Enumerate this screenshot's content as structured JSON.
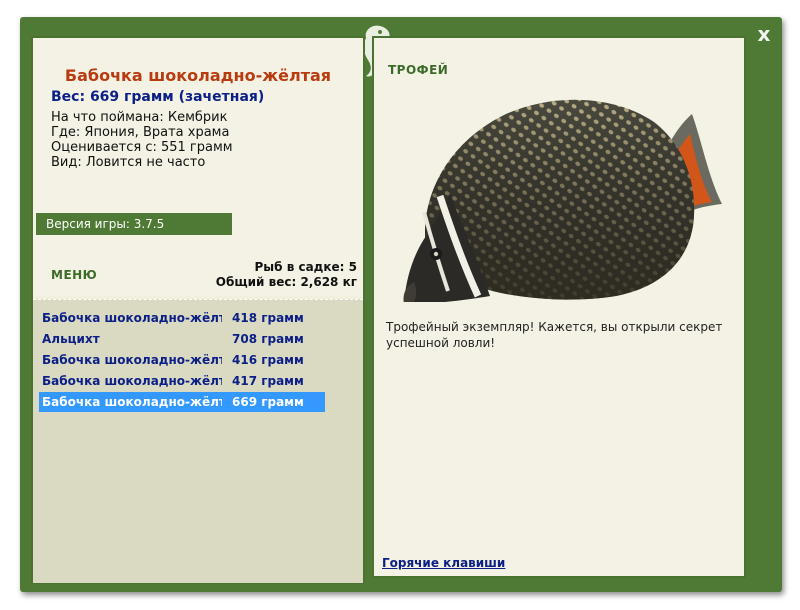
{
  "window": {
    "close_label": "x"
  },
  "catch": {
    "title": "Бабочка шоколадно-жёлтая",
    "weight_line": "Вес: 669 грамм (зачетная)",
    "bait_line": "На что поймана: Кембрик",
    "location_line": "Где: Япония, Врата храма",
    "price_line": "Оценивается с: 551 грамм",
    "rarity_line": "Вид: Ловится не часто"
  },
  "version_label": "Версия игры: 3.7.5",
  "menu_label": "МЕНЮ",
  "cage": {
    "fish_count_line": "Рыб в садке: 5",
    "total_weight_line": "Общий вес: 2,628 кг"
  },
  "fish_list": [
    {
      "name": "Бабочка шоколадно-жёлтая",
      "weight": "418 грамм",
      "selected": false
    },
    {
      "name": "Альцихт",
      "weight": "708 грамм",
      "selected": false
    },
    {
      "name": "Бабочка шоколадно-жёлтая",
      "weight": "416 грамм",
      "selected": false
    },
    {
      "name": "Бабочка шоколадно-жёлтая",
      "weight": "417 грамм",
      "selected": false
    },
    {
      "name": "Бабочка шоколадно-жёлтая",
      "weight": "669 грамм",
      "selected": true
    }
  ],
  "trophy": {
    "label": "ТРОФЕЙ",
    "message": "Трофейный экземпляр! Кажется, вы открыли секрет успешной ловли!",
    "image_icon": "butterflyfish-image"
  },
  "hotkeys_label": "Горячие клавиши",
  "colors": {
    "frame": "#4f7a35",
    "panel": "#f3f2e4",
    "list_bg": "#dad9c2",
    "title": "#b93b10",
    "link": "#0b1f86",
    "selected": "#3399ff"
  }
}
